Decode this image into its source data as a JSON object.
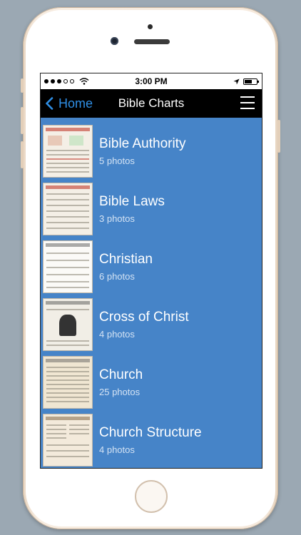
{
  "status_bar": {
    "time": "3:00 PM"
  },
  "navbar": {
    "back_label": "Home",
    "title": "Bible Charts",
    "menu_icon": "hamburger-icon"
  },
  "albums": [
    {
      "title": "Bible Authority",
      "count": "5 photos"
    },
    {
      "title": "Bible Laws",
      "count": "3 photos"
    },
    {
      "title": "Christian",
      "count": "6 photos"
    },
    {
      "title": "Cross of Christ",
      "count": "4 photos"
    },
    {
      "title": "Church",
      "count": "25 photos"
    },
    {
      "title": "Church Structure",
      "count": "4 photos"
    }
  ],
  "colors": {
    "list_background": "#4684c8",
    "navbar": "#000000",
    "back_link": "#2f8fe6",
    "device_background": "#9ba8b3"
  }
}
